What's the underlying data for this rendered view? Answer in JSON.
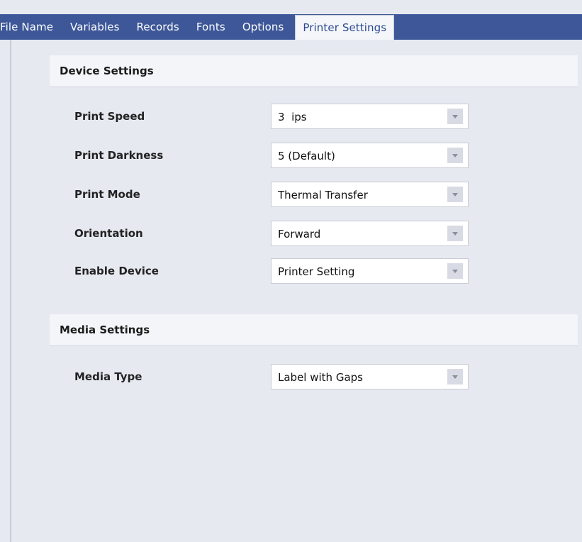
{
  "tabs": [
    "File Name",
    "Variables",
    "Records",
    "Fonts",
    "Options",
    "Printer Settings"
  ],
  "active_tab": "Printer Settings",
  "device_settings": {
    "title": "Device Settings",
    "fields": [
      {
        "label": "Print Speed",
        "value": "3  ips"
      },
      {
        "label": "Print Darkness",
        "value": "5 (Default)"
      },
      {
        "label": "Print Mode",
        "value": "Thermal Transfer"
      },
      {
        "label": "Orientation",
        "value": "Forward"
      },
      {
        "label": "Enable Device",
        "value": "Printer Setting"
      }
    ]
  },
  "media_settings": {
    "title": "Media Settings",
    "fields": [
      {
        "label": "Media Type",
        "value": "Label with Gaps"
      }
    ]
  },
  "icons": {
    "dropdown": "chevron-down-icon"
  },
  "colors": {
    "tab_bar": "#3d5798",
    "active_tab_text": "#2c4a8f",
    "panel_background": "#e7e9f1"
  }
}
